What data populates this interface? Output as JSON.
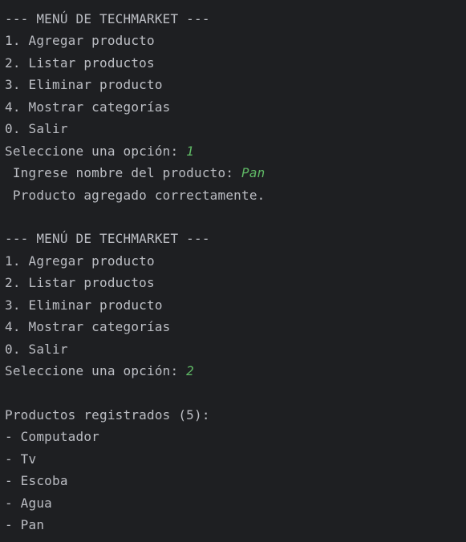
{
  "console": {
    "lines": [
      {
        "text": "--- MENÚ DE TECHMARKET ---",
        "input": ""
      },
      {
        "text": "1. Agregar producto",
        "input": ""
      },
      {
        "text": "2. Listar productos",
        "input": ""
      },
      {
        "text": "3. Eliminar producto",
        "input": ""
      },
      {
        "text": "4. Mostrar categorías",
        "input": ""
      },
      {
        "text": "0. Salir",
        "input": ""
      },
      {
        "text": "Seleccione una opción: ",
        "input": "1"
      },
      {
        "text": " Ingrese nombre del producto: ",
        "input": "Pan"
      },
      {
        "text": " Producto agregado correctamente.",
        "input": ""
      },
      {
        "text": "",
        "input": ""
      },
      {
        "text": "--- MENÚ DE TECHMARKET ---",
        "input": ""
      },
      {
        "text": "1. Agregar producto",
        "input": ""
      },
      {
        "text": "2. Listar productos",
        "input": ""
      },
      {
        "text": "3. Eliminar producto",
        "input": ""
      },
      {
        "text": "4. Mostrar categorías",
        "input": ""
      },
      {
        "text": "0. Salir",
        "input": ""
      },
      {
        "text": "Seleccione una opción: ",
        "input": "2"
      },
      {
        "text": "",
        "input": ""
      },
      {
        "text": "Productos registrados (5):",
        "input": ""
      },
      {
        "text": "- Computador",
        "input": ""
      },
      {
        "text": "- Tv",
        "input": ""
      },
      {
        "text": "- Escoba",
        "input": ""
      },
      {
        "text": "- Agua",
        "input": ""
      },
      {
        "text": "- Pan",
        "input": ""
      }
    ]
  },
  "colors": {
    "background": "#1e1f22",
    "text": "#bcbec4",
    "user_input": "#5fb865"
  }
}
